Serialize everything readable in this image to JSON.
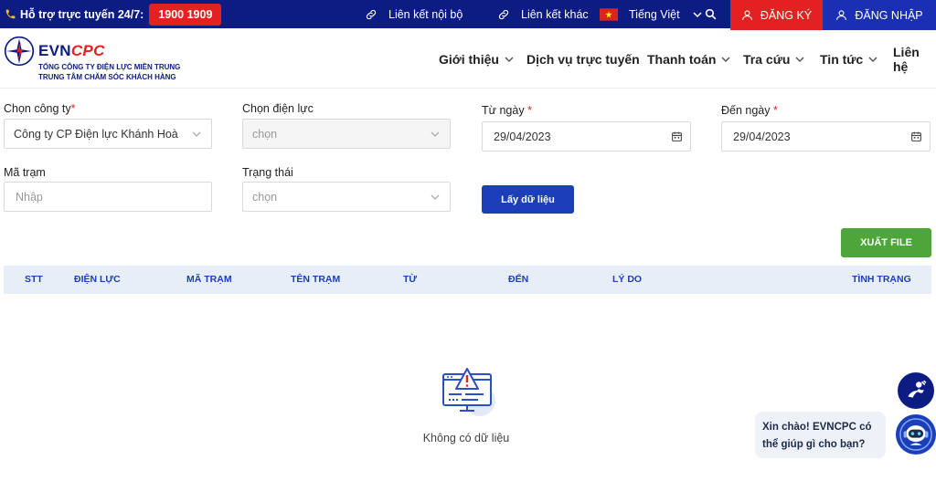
{
  "topbar": {
    "hotline_label": "Hỗ trợ trực tuyến 24/7:",
    "hotline_number": "1900 1909",
    "internal_link": "Liên kết nội bộ",
    "other_link": "Liên kết khác",
    "language": "Tiếng Việt",
    "register": "ĐĂNG KÝ",
    "login": "ĐĂNG NHẬP"
  },
  "brand": {
    "name_part1": "EVN",
    "name_part2": "CPC",
    "line1": "TỔNG CÔNG TY ĐIỆN LỰC MIỀN TRUNG",
    "line2": "TRUNG TÂM CHĂM SÓC KHÁCH HÀNG"
  },
  "nav": {
    "items": [
      "Giới thiệu",
      "Dịch vụ trực tuyến",
      "Thanh toán",
      "Tra cứu",
      "Tin tức",
      "Liên hệ"
    ]
  },
  "form": {
    "company_label": "Chọn công ty",
    "company_value": "Công ty CP Điện lực Khánh Hoà",
    "unit_label": "Chọn điện lực",
    "unit_placeholder": "chọn",
    "from_label": "Từ ngày",
    "from_value": "29/04/2023",
    "to_label": "Đến ngày",
    "to_value": "29/04/2023",
    "station_label": "Mã trạm",
    "station_placeholder": "Nhập",
    "status_label": "Trạng thái",
    "status_placeholder": "chọn",
    "required_mark": "*",
    "get_button": "Lấy dữ liệu",
    "export_button": "XUẤT FILE"
  },
  "table": {
    "columns": [
      "STT",
      "ĐIỆN LỰC",
      "MÃ TRẠM",
      "TÊN TRẠM",
      "TỪ",
      "ĐẾN",
      "LÝ DO",
      "TÌNH TRẠNG"
    ],
    "empty_text": "Không có dữ liệu"
  },
  "chat": {
    "line1": "Xin chào! EVNCPC có",
    "line2": "thể giúp gì cho bạn?"
  },
  "colors": {
    "primary": "#0d1c83",
    "accent_red": "#e32121",
    "button_blue": "#1a3fb8",
    "export_green": "#4ea53a"
  }
}
